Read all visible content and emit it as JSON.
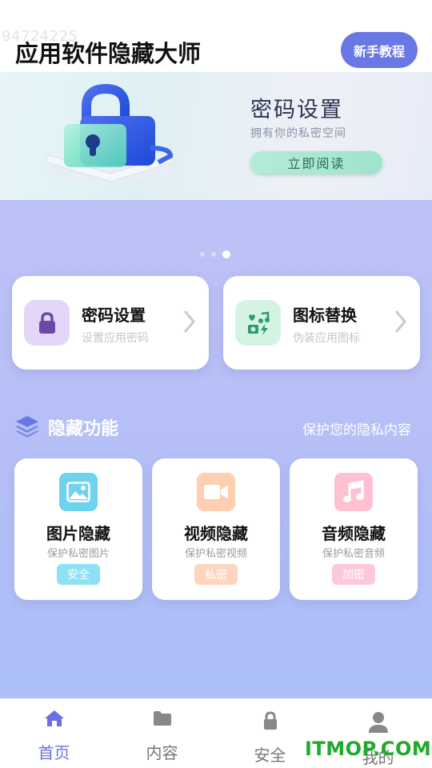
{
  "header": {
    "watermark": "94724225",
    "title": "应用软件隐藏大师",
    "tutorial_button": "新手教程"
  },
  "banner": {
    "title": "密码设置",
    "subtitle": "拥有你的私密空间",
    "button": "立即阅读",
    "page_indicator": {
      "count": 3,
      "active": 3
    }
  },
  "quick_cards": [
    {
      "title": "密码设置",
      "subtitle": "设置应用密码",
      "icon": "lock-icon"
    },
    {
      "title": "图标替换",
      "subtitle": "伪装应用图标",
      "icon": "icon-swap-icon"
    }
  ],
  "section": {
    "title": "隐藏功能",
    "subtitle": "保护您的隐私内容",
    "icon": "layers-icon"
  },
  "features": [
    {
      "title": "图片隐藏",
      "subtitle": "保护私密图片",
      "tag": "安全",
      "icon": "image-icon",
      "color": "#6fd2ee"
    },
    {
      "title": "视频隐藏",
      "subtitle": "保护私密视频",
      "tag": "私密",
      "icon": "video-icon",
      "color": "#ffcfb2"
    },
    {
      "title": "音频隐藏",
      "subtitle": "保护私密音频",
      "tag": "加密",
      "icon": "music-icon",
      "color": "#ffc0d2"
    }
  ],
  "bottom_nav": [
    {
      "label": "首页",
      "icon": "home-icon",
      "active": true
    },
    {
      "label": "内容",
      "icon": "folder-icon",
      "active": false
    },
    {
      "label": "安全",
      "icon": "lock-icon",
      "active": false
    },
    {
      "label": "我的",
      "icon": "user-icon",
      "active": false
    }
  ],
  "site_watermark": "ITMOP.COM",
  "colors": {
    "accent": "#6a78e6",
    "nav_active": "#6a6fe6",
    "background_top": "#c3c6f7",
    "background_bottom": "#a9bdf8"
  }
}
